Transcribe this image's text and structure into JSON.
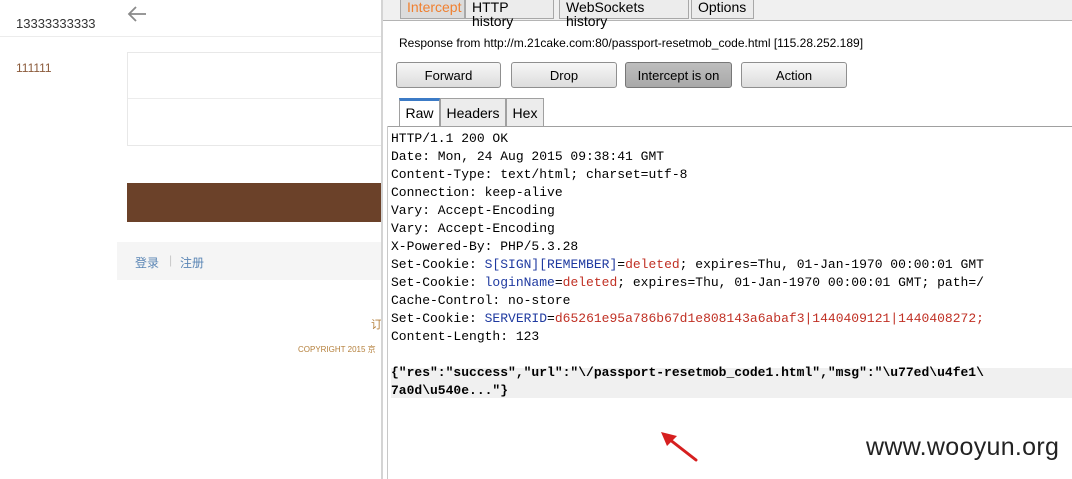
{
  "mobile_page": {
    "phone_value": "13333333333",
    "code_value": "111111",
    "login_link": "登录",
    "separator": "|",
    "register_link": "注册",
    "footer_char": "订",
    "copyright": "COPYRIGHT 2015 京"
  },
  "burp": {
    "tabs": [
      "Intercept",
      "HTTP history",
      "WebSockets history",
      "Options"
    ],
    "response_info": "Response from http://m.21cake.com:80/passport-resetmob_code.html  [115.28.252.189]",
    "buttons": {
      "forward": "Forward",
      "drop": "Drop",
      "intercept": "Intercept is on",
      "action": "Action"
    },
    "view_tabs": [
      "Raw",
      "Headers",
      "Hex"
    ],
    "response": {
      "status_line": "HTTP/1.1 200 OK",
      "date": "Date: Mon, 24 Aug 2015 09:38:41 GMT",
      "content_type": "Content-Type: text/html; charset=utf-8",
      "connection": "Connection: keep-alive",
      "vary1": "Vary: Accept-Encoding",
      "vary2": "Vary: Accept-Encoding",
      "powered_by": "X-Powered-By: PHP/5.3.28",
      "cookie1": {
        "prefix": "Set-Cookie: ",
        "name": "S[SIGN][REMEMBER]",
        "eq": "=",
        "value": "deleted",
        "rest": "; expires=Thu, 01-Jan-1970 00:00:01 GMT"
      },
      "cookie2": {
        "prefix": "Set-Cookie: ",
        "name": "loginName",
        "eq": "=",
        "value": "deleted",
        "rest": "; expires=Thu, 01-Jan-1970 00:00:01 GMT; path=/"
      },
      "cache_control": "Cache-Control: no-store",
      "cookie3": {
        "prefix": "Set-Cookie: ",
        "name": "SERVERID",
        "eq": "=",
        "value": "d65261e95a786b67d1e808143a6abaf3|1440409121|1440408272;"
      },
      "content_length": "Content-Length: 123",
      "body_line1": "{\"res\":\"success\",\"url\":\"\\/passport-resetmob_code1.html\",\"msg\":\"\\u77ed\\u4fe1\\",
      "body_line2": "7a0d\\u540e...\"}"
    }
  },
  "watermark": "www.wooyun.org",
  "colors": {
    "accent": "#6b4129",
    "active_tab": "#f08030",
    "cookie_name": "#1f3aa0",
    "cookie_value": "#c03024"
  }
}
